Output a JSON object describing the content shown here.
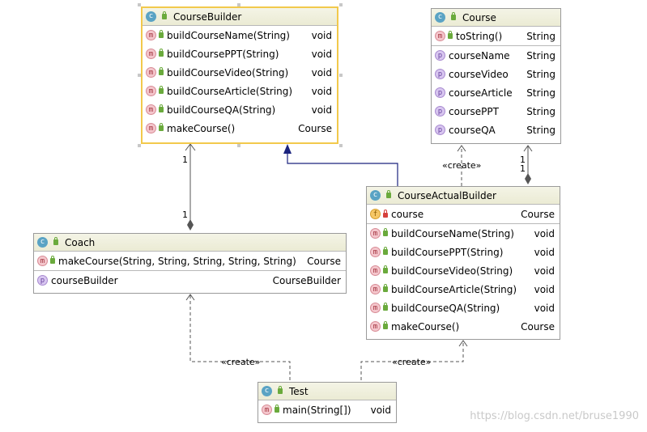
{
  "classes": {
    "course_builder": {
      "name": "CourseBuilder",
      "methods": [
        {
          "name": "buildCourseName(String)",
          "type": "void"
        },
        {
          "name": "buildCoursePPT(String)",
          "type": "void"
        },
        {
          "name": "buildCourseVideo(String)",
          "type": "void"
        },
        {
          "name": "buildCourseArticle(String)",
          "type": "void"
        },
        {
          "name": "buildCourseQA(String)",
          "type": "void"
        },
        {
          "name": "makeCourse()",
          "type": "Course"
        }
      ]
    },
    "course": {
      "name": "Course",
      "methods": [
        {
          "name": "toString()",
          "type": "String"
        }
      ],
      "properties": [
        {
          "name": "courseName",
          "type": "String"
        },
        {
          "name": "courseVideo",
          "type": "String"
        },
        {
          "name": "courseArticle",
          "type": "String"
        },
        {
          "name": "coursePPT",
          "type": "String"
        },
        {
          "name": "courseQA",
          "type": "String"
        }
      ]
    },
    "coach": {
      "name": "Coach",
      "methods": [
        {
          "name": "makeCourse(String, String, String, String, String)",
          "type": "Course"
        }
      ],
      "properties": [
        {
          "name": "courseBuilder",
          "type": "CourseBuilder"
        }
      ]
    },
    "course_actual_builder": {
      "name": "CourseActualBuilder",
      "fields": [
        {
          "name": "course",
          "type": "Course"
        }
      ],
      "methods": [
        {
          "name": "buildCourseName(String)",
          "type": "void"
        },
        {
          "name": "buildCoursePPT(String)",
          "type": "void"
        },
        {
          "name": "buildCourseVideo(String)",
          "type": "void"
        },
        {
          "name": "buildCourseArticle(String)",
          "type": "void"
        },
        {
          "name": "buildCourseQA(String)",
          "type": "void"
        },
        {
          "name": "makeCourse()",
          "type": "Course"
        }
      ]
    },
    "test": {
      "name": "Test",
      "methods": [
        {
          "name": "main(String[])",
          "type": "void"
        }
      ]
    }
  },
  "badges": {
    "class": "c",
    "method": "m",
    "property": "p",
    "field": "f"
  },
  "labels": {
    "create_course": "«create»",
    "create_coach": "«create»",
    "create_builder": "«create»",
    "mult_coach_top": "1",
    "mult_coach_bottom": "1",
    "mult_course_a": "1",
    "mult_course_b": "1"
  },
  "watermark": "https://blog.csdn.net/bruse1990",
  "colors": {
    "selection": "#f2c94c",
    "inheritance": "#1a237e",
    "line": "#555555"
  }
}
